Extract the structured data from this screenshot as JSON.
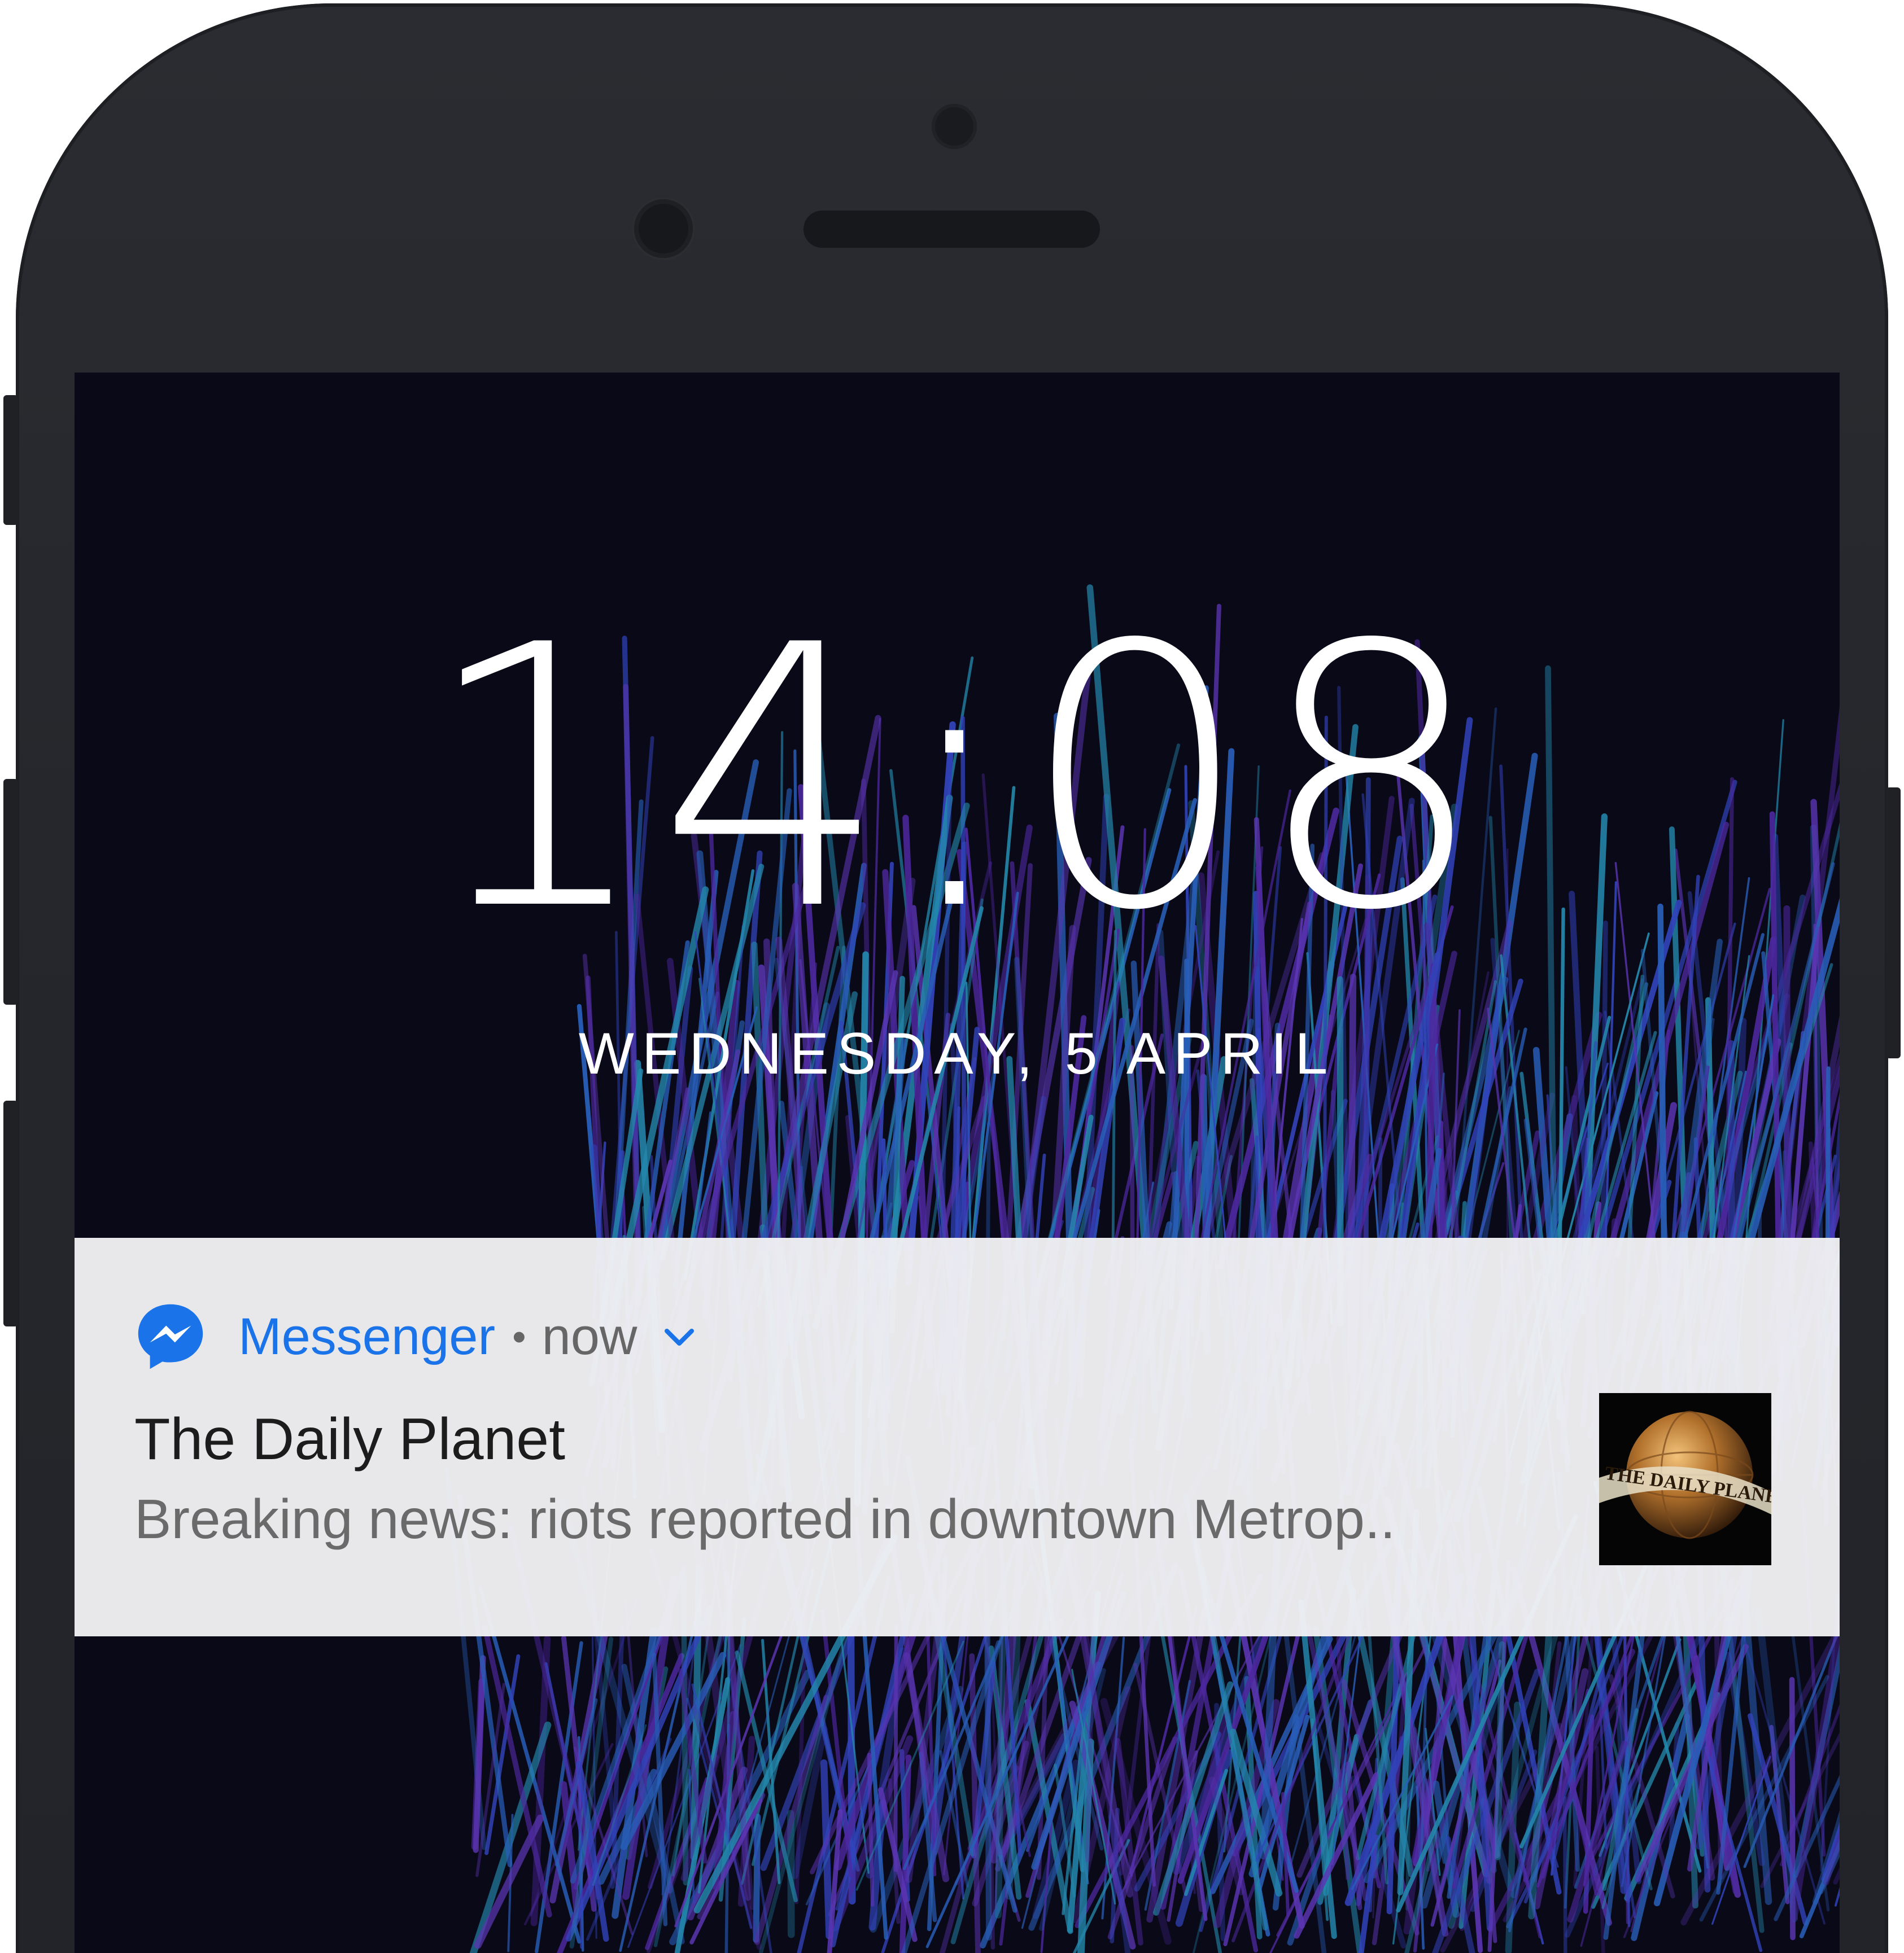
{
  "lockscreen": {
    "time": "14:08",
    "date": "WEDNESDAY, 5 APRIL"
  },
  "notification": {
    "app_name": "Messenger",
    "separator": "•",
    "timestamp": "now",
    "title": "The Daily Planet",
    "body": "Breaking news: riots reported in downtown Metrop..",
    "app_icon": "messenger-icon",
    "expand_icon": "chevron-down-icon",
    "thumbnail_icon": "daily-planet-logo"
  },
  "colors": {
    "messenger_blue": "#1a73e8",
    "wallpaper_bg": "#0a0918",
    "feather_blue": "#2f6fd6",
    "feather_purple": "#6b3fd0",
    "feather_teal": "#2aa0c8"
  }
}
